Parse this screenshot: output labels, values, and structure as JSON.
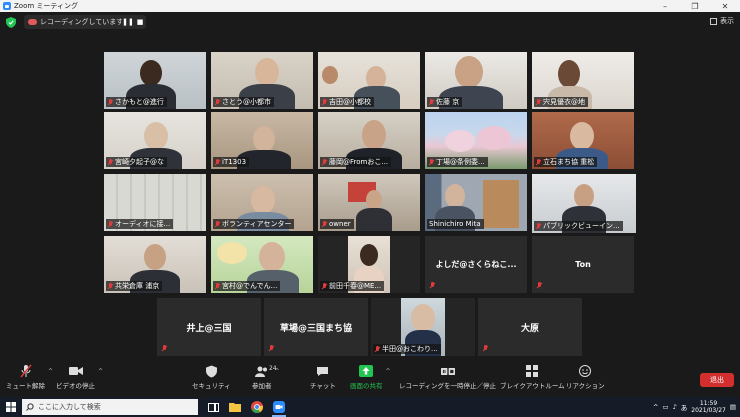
{
  "window": {
    "title": "Zoom ミーティング",
    "controls": [
      "–",
      "❐",
      "✕"
    ]
  },
  "top": {
    "recording_label": "レコーディングしています...",
    "view_label": "表示"
  },
  "participants": [
    {
      "name": "さかもと@進行",
      "muted": true
    },
    {
      "name": "さとう@小都市",
      "muted": true
    },
    {
      "name": "吉田@小都校",
      "muted": true
    },
    {
      "name": "佐藤 京",
      "muted": true
    },
    {
      "name": "宍見優衣@地",
      "muted": true
    },
    {
      "name": "宮崎夕起子@な",
      "muted": true
    },
    {
      "name": "iT1303",
      "muted": true
    },
    {
      "name": "藤岡@Fromおこ...",
      "muted": true
    },
    {
      "name": "丁場@条例委...",
      "muted": true
    },
    {
      "name": "立石まち協 重松",
      "muted": true
    },
    {
      "name": "オーディオに接...",
      "muted": true
    },
    {
      "name": "ボランティアセンター",
      "muted": true
    },
    {
      "name": "owner",
      "muted": true
    },
    {
      "name": "Shinichiro Mita",
      "muted": true
    },
    {
      "name": "パブリックビューイン...",
      "muted": true
    },
    {
      "name": "共栄倉庫 浦京",
      "muted": true
    },
    {
      "name": "宮村@でんでん...",
      "muted": true
    },
    {
      "name": "前田千春@ME...",
      "muted": true
    },
    {
      "name": "よしだ@さくらねこ...",
      "muted": true,
      "video_off": true
    },
    {
      "name": "Ton",
      "muted": true,
      "video_off": true
    },
    {
      "name": "井上@三国",
      "muted": true,
      "video_off": true
    },
    {
      "name": "草場@三国まち協",
      "muted": true,
      "video_off": true
    },
    {
      "name": "半田@おこわり...",
      "muted": true
    },
    {
      "name": "大原",
      "muted": true,
      "video_off": true
    }
  ],
  "toolbar": {
    "mute": "ミュート解除",
    "video": "ビデオの停止",
    "security": "セキュリティ",
    "participants": "参加者",
    "participants_count": "24",
    "chat": "チャット",
    "share": "画面の共有",
    "record": "レコーディングを一時停止／停止",
    "breakout": "ブレイクアウトルーム",
    "reactions": "リアクション",
    "leave": "退出"
  },
  "taskbar": {
    "search_placeholder": "ここに入力して検索",
    "ime": "あ",
    "time": "11:59",
    "date": "2021/03/27"
  },
  "colors": {
    "share_green": "#23c552",
    "leave_red": "#d42f2f",
    "active_speaker": "#b7e46a",
    "muted_red": "#e23b3b"
  }
}
